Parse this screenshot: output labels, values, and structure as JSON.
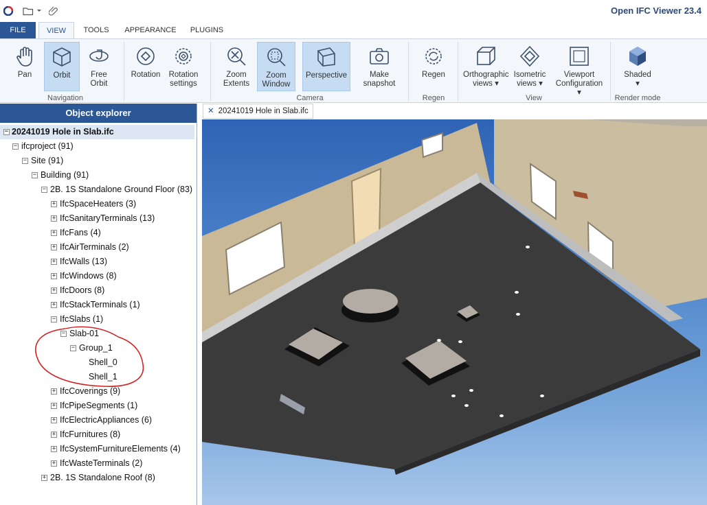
{
  "app": {
    "title": "Open IFC Viewer 23.4"
  },
  "quick_access": {
    "icons": [
      "app-logo-icon",
      "folder-open-icon",
      "chevron-down-icon",
      "paperclip-icon"
    ]
  },
  "tabs": [
    "FILE",
    "VIEW",
    "TOOLS",
    "APPEARANCE",
    "PLUGINS"
  ],
  "ribbon": {
    "navigation": {
      "label": "Navigation",
      "pan": "Pan",
      "orbit": "Orbit",
      "free_orbit": "Free Orbit"
    },
    "rotation": {
      "rotation": "Rotation",
      "rotation_settings_1": "Rotation",
      "rotation_settings_2": "settings"
    },
    "camera": {
      "label": "Camera",
      "zoom_extents_1": "Zoom",
      "zoom_extents_2": "Extents",
      "zoom_window_1": "Zoom",
      "zoom_window_2": "Window",
      "perspective": "Perspective",
      "snapshot_1": "Make",
      "snapshot_2": "snapshot"
    },
    "regen": {
      "label": "Regen",
      "regen": "Regen"
    },
    "view": {
      "label": "View",
      "ortho_1": "Orthographic",
      "ortho_2": "views",
      "iso_1": "Isometric",
      "iso_2": "views",
      "viewport_1": "Viewport",
      "viewport_2": "Configuration"
    },
    "render": {
      "label": "Render mode",
      "shaded": "Shaded"
    }
  },
  "explorer": {
    "title": "Object explorer",
    "nodes": [
      "20241019 Hole in Slab.ifc",
      "ifcproject (91)",
      "Site (91)",
      "Building (91)",
      "2B. 1S Standalone Ground Floor (83)",
      "IfcSpaceHeaters (3)",
      "IfcSanitaryTerminals (13)",
      "IfcFans (4)",
      "IfcAirTerminals (2)",
      "IfcWalls (13)",
      "IfcWindows (8)",
      "IfcDoors (8)",
      "IfcStackTerminals (1)",
      "IfcSlabs (1)",
      "Slab-01",
      "Group_1",
      "Shell_0",
      "Shell_1",
      "IfcCoverings (9)",
      "IfcPipeSegments (1)",
      "IfcElectricAppliances (6)",
      "IfcFurnitures (8)",
      "IfcSystemFurnitureElements (4)",
      "IfcWasteTerminals (2)",
      "2B. 1S Standalone Roof (8)"
    ]
  },
  "document_tab": {
    "label": "20241019 Hole in Slab.ifc"
  },
  "colors": {
    "accent": "#2b5797",
    "annotation": "#d42020",
    "slab": "#3a3a3a",
    "wall": "#c7b79a"
  }
}
